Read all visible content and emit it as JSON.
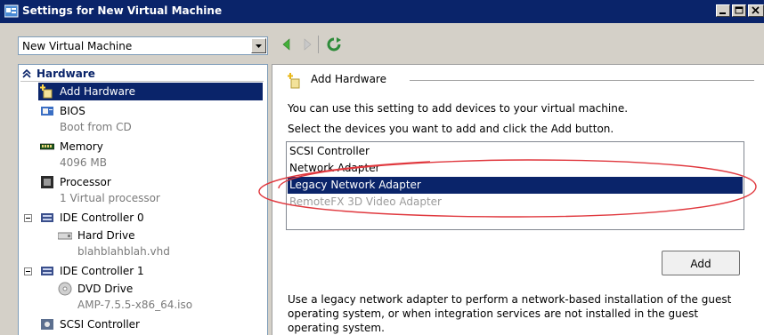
{
  "window": {
    "title": "Settings for New Virtual Machine"
  },
  "toolbar": {
    "vm_selected": "New Virtual Machine"
  },
  "tree": {
    "hardware_label": "Hardware",
    "add_hardware": "Add Hardware",
    "items": [
      {
        "name": "BIOS",
        "sub": "Boot from CD"
      },
      {
        "name": "Memory",
        "sub": "4096 MB"
      },
      {
        "name": "Processor",
        "sub": "1 Virtual processor"
      }
    ],
    "ide0": {
      "name": "IDE Controller 0",
      "child_name": "Hard Drive",
      "child_sub": "blahblahblah.vhd"
    },
    "ide1": {
      "name": "IDE Controller 1",
      "child_name": "DVD Drive",
      "child_sub": "AMP-7.5.5-x86_64.iso"
    },
    "scsi": {
      "name": "SCSI Controller"
    }
  },
  "panel": {
    "group_title": "Add Hardware",
    "intro": "You can use this setting to add devices to your virtual machine.",
    "instruction": "Select the devices you want to add and click the Add button.",
    "devices": [
      "SCSI Controller",
      "Network Adapter",
      "Legacy Network Adapter",
      "RemoteFX 3D Video Adapter"
    ],
    "selected_device": "Legacy Network Adapter",
    "add_button": "Add",
    "description": "Use a legacy network adapter to perform a network-based installation of the guest operating system, or when integration services are not installed in the guest operating system."
  },
  "colors": {
    "titlebar": "#0a246a",
    "selection": "#0a246a",
    "annotation": "#e0383e",
    "chrome": "#d4d0c8"
  }
}
